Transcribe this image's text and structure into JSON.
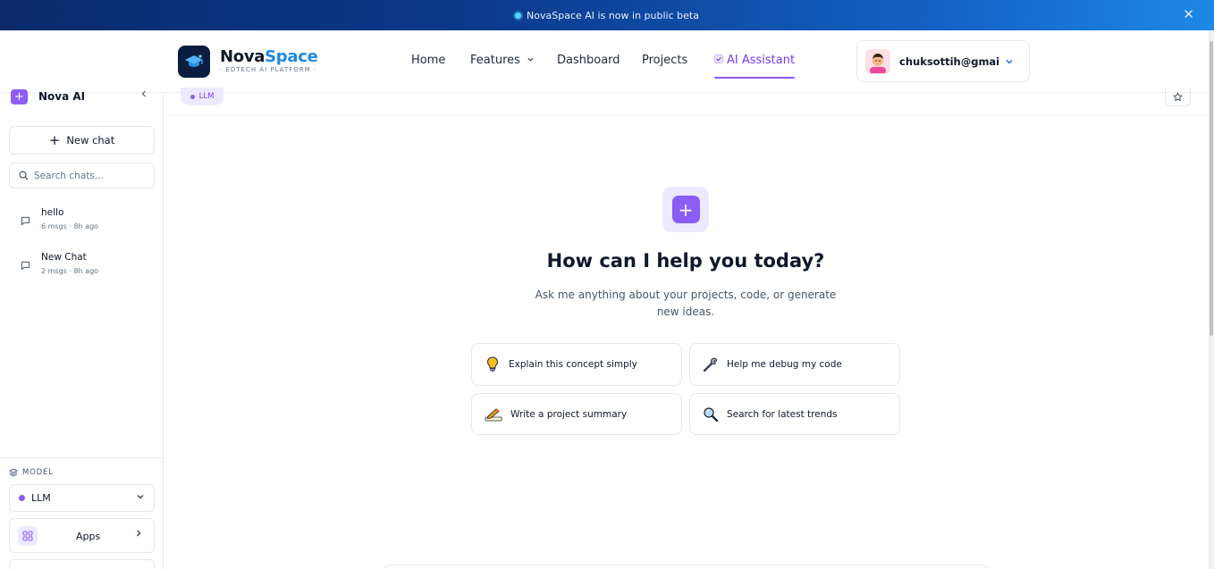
{
  "banner": {
    "text": "NovaSpace AI is now in public beta",
    "close": "✕"
  },
  "header": {
    "brand_part1": "Nova",
    "brand_part2": "Space",
    "brand_subtitle": "· EDTECH AI PLATFORM ·",
    "nav": {
      "home": "Home",
      "features": "Features",
      "dashboard": "Dashboard",
      "projects": "Projects",
      "ai_assistant": "AI Assistant"
    },
    "user_email": "chuksottih@gmail..."
  },
  "sidebar": {
    "title": "Nova AI",
    "new_chat": "New chat",
    "search_placeholder": "Search chats...",
    "chats": [
      {
        "title": "hello",
        "meta": "6 msgs · 8h ago"
      },
      {
        "title": "New Chat",
        "meta": "2 msgs · 8h ago"
      }
    ],
    "model_label": "MODEL",
    "model_value": "LLM",
    "apps_label": "Apps"
  },
  "main": {
    "model_pill": "LLM",
    "hero_title": "How can I help you today?",
    "hero_subtitle": "Ask me anything about your projects, code, or generate new ideas.",
    "suggestions": [
      {
        "label": "Explain this concept simply",
        "icon": "lightbulb-icon"
      },
      {
        "label": "Help me debug my code",
        "icon": "wrench-icon"
      },
      {
        "label": "Write a project summary",
        "icon": "pencil-writing-icon"
      },
      {
        "label": "Search for latest trends",
        "icon": "magnifier-icon"
      }
    ]
  },
  "colors": {
    "accent": "#8b5cf6",
    "brand_blue": "#1e88e5",
    "banner_dark": "#0a2a6b",
    "navy": "#0b1e3f"
  }
}
